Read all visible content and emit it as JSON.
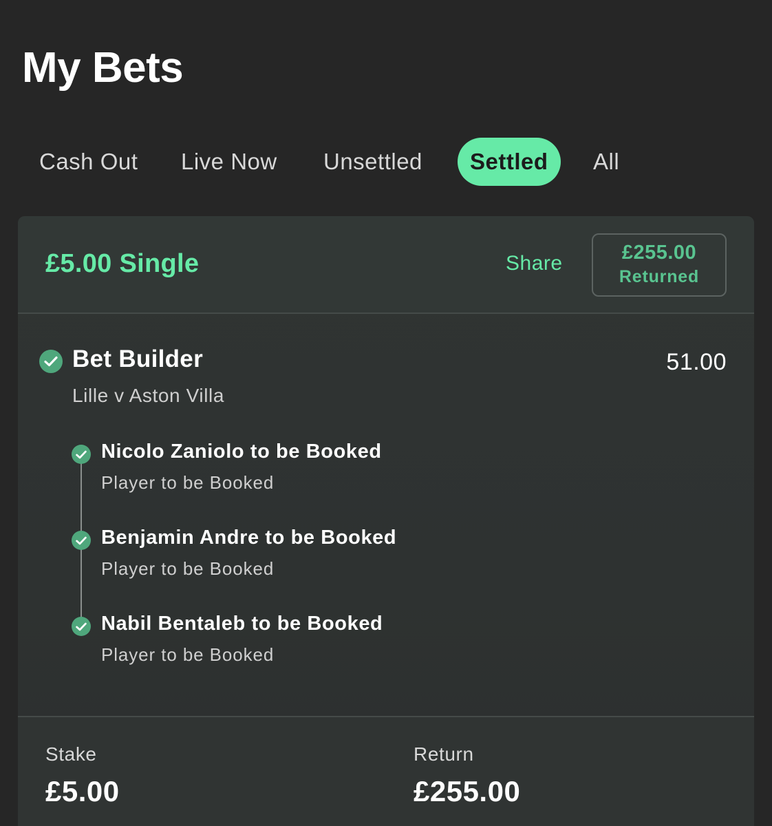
{
  "page": {
    "title": "My Bets"
  },
  "tabs": [
    {
      "label": "Cash Out",
      "active": false
    },
    {
      "label": "Live Now",
      "active": false
    },
    {
      "label": "Unsettled",
      "active": false
    },
    {
      "label": "Settled",
      "active": true
    },
    {
      "label": "All",
      "active": false
    }
  ],
  "bet": {
    "title": "£5.00 Single",
    "share_label": "Share",
    "returned_amount": "£255.00",
    "returned_label": "Returned",
    "builder": {
      "title": "Bet Builder",
      "match": "Lille v Aston Villa",
      "odds": "51.00",
      "status_icon": "check-circle-icon"
    },
    "legs": [
      {
        "title": "Nicolo Zaniolo to be Booked",
        "market": "Player to be Booked"
      },
      {
        "title": "Benjamin Andre to be Booked",
        "market": "Player to be Booked"
      },
      {
        "title": "Nabil Bentaleb to be Booked",
        "market": "Player to be Booked"
      }
    ],
    "stake_label": "Stake",
    "stake_value": "£5.00",
    "return_label": "Return",
    "return_value": "£255.00"
  },
  "colors": {
    "background": "#262626",
    "accent": "#66eaa7",
    "win_green": "#4fa77c",
    "card": "#303433"
  }
}
